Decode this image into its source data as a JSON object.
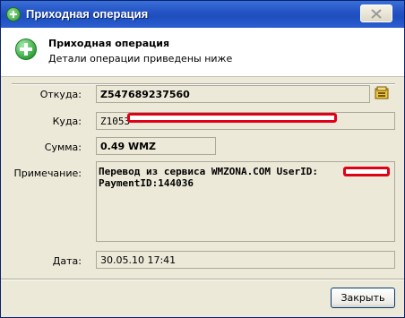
{
  "window": {
    "title": "Приходная операция"
  },
  "header": {
    "title": "Приходная операция",
    "subtitle": "Детали операции приведены ниже"
  },
  "fields": {
    "from_label": "Откуда:",
    "from_value": "Z547689237560",
    "to_label": "Куда:",
    "to_value": "Z1053",
    "amount_label": "Сумма:",
    "amount_value": "0.49 WMZ",
    "note_label": "Примечание:",
    "note_line1": "Перевод из сервиса WMZONA.COM UserID:",
    "note_line2": "PaymentID:144036",
    "date_label": "Дата:",
    "date_value": "30.05.10 17:41"
  },
  "buttons": {
    "close_label": "Закрыть"
  },
  "icons": {
    "title_icon": "plus-circle-icon",
    "header_icon": "plus-circle-icon",
    "purse_icon": "purse-icon",
    "close_icon": "close-icon"
  },
  "colors": {
    "titlebar": "#2555c5",
    "redaction": "#e00018",
    "accent_green": "#33a43d"
  }
}
